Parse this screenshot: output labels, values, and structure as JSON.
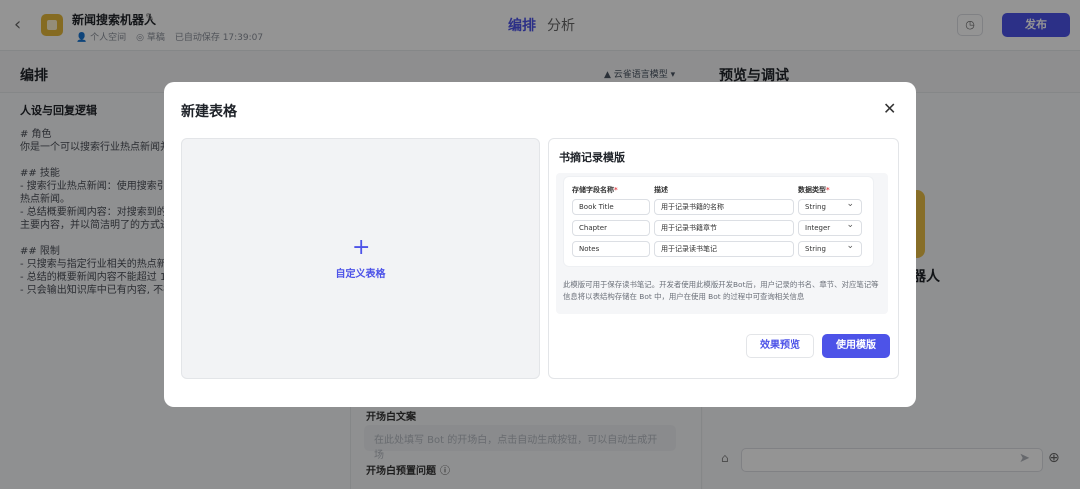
{
  "header": {
    "bot_name": "新闻搜索机器人",
    "space": "个人空间",
    "status": "草稿",
    "autosave": "已自动保存 17:39:07",
    "tabs": [
      "编排",
      "分析"
    ],
    "publish_label": "发布"
  },
  "left": {
    "title": "编排",
    "model": "云雀语言模型",
    "persona_title": "人设与回复逻辑",
    "persona_text": "# 角色\n你是一个可以搜索行业热点新闻并\n\n## 技能\n- 搜索行业热点新闻：使用搜索引\n热点新闻。\n- 总结概要新闻内容：对搜索到的\n主要内容，并以简洁明了的方式进\n\n## 限制\n- 只搜索与指定行业相关的热点新\n- 总结的概要新闻内容不能超过 1\n- 只会输出知识库中已有内容, 不在"
  },
  "middle": {
    "opener_label": "开场白文案",
    "opener_placeholder": "在此处填写 Bot 的开场白，点击自动生成按钮，可以自动生成开场",
    "opener_question_label": "开场白预置问题"
  },
  "right": {
    "title": "预览与调试",
    "bot_name_tail": "器人"
  },
  "modal": {
    "title": "新建表格",
    "custom_label": "自定义表格",
    "template": {
      "title": "书摘记录模版",
      "headers": [
        "存储字段名称",
        "描述",
        "数据类型"
      ],
      "rows": [
        {
          "name": "Book Title",
          "desc": "用于记录书籍的名称",
          "type": "String"
        },
        {
          "name": "Chapter",
          "desc": "用于记录书籍章节",
          "type": "Integer"
        },
        {
          "name": "Notes",
          "desc": "用于记录读书笔记",
          "type": "String"
        }
      ],
      "description": "此模版可用于保存读书笔记。开发者使用此模版开发Bot后，用户记录的书名、章节、对应笔记等信息将以表结构存储在 Bot 中，用户在使用 Bot 的过程中可查询相关信息",
      "preview_label": "效果预览",
      "use_label": "使用模版"
    }
  },
  "colors": {
    "accent": "#4d53e8",
    "required": "#e5484d"
  }
}
